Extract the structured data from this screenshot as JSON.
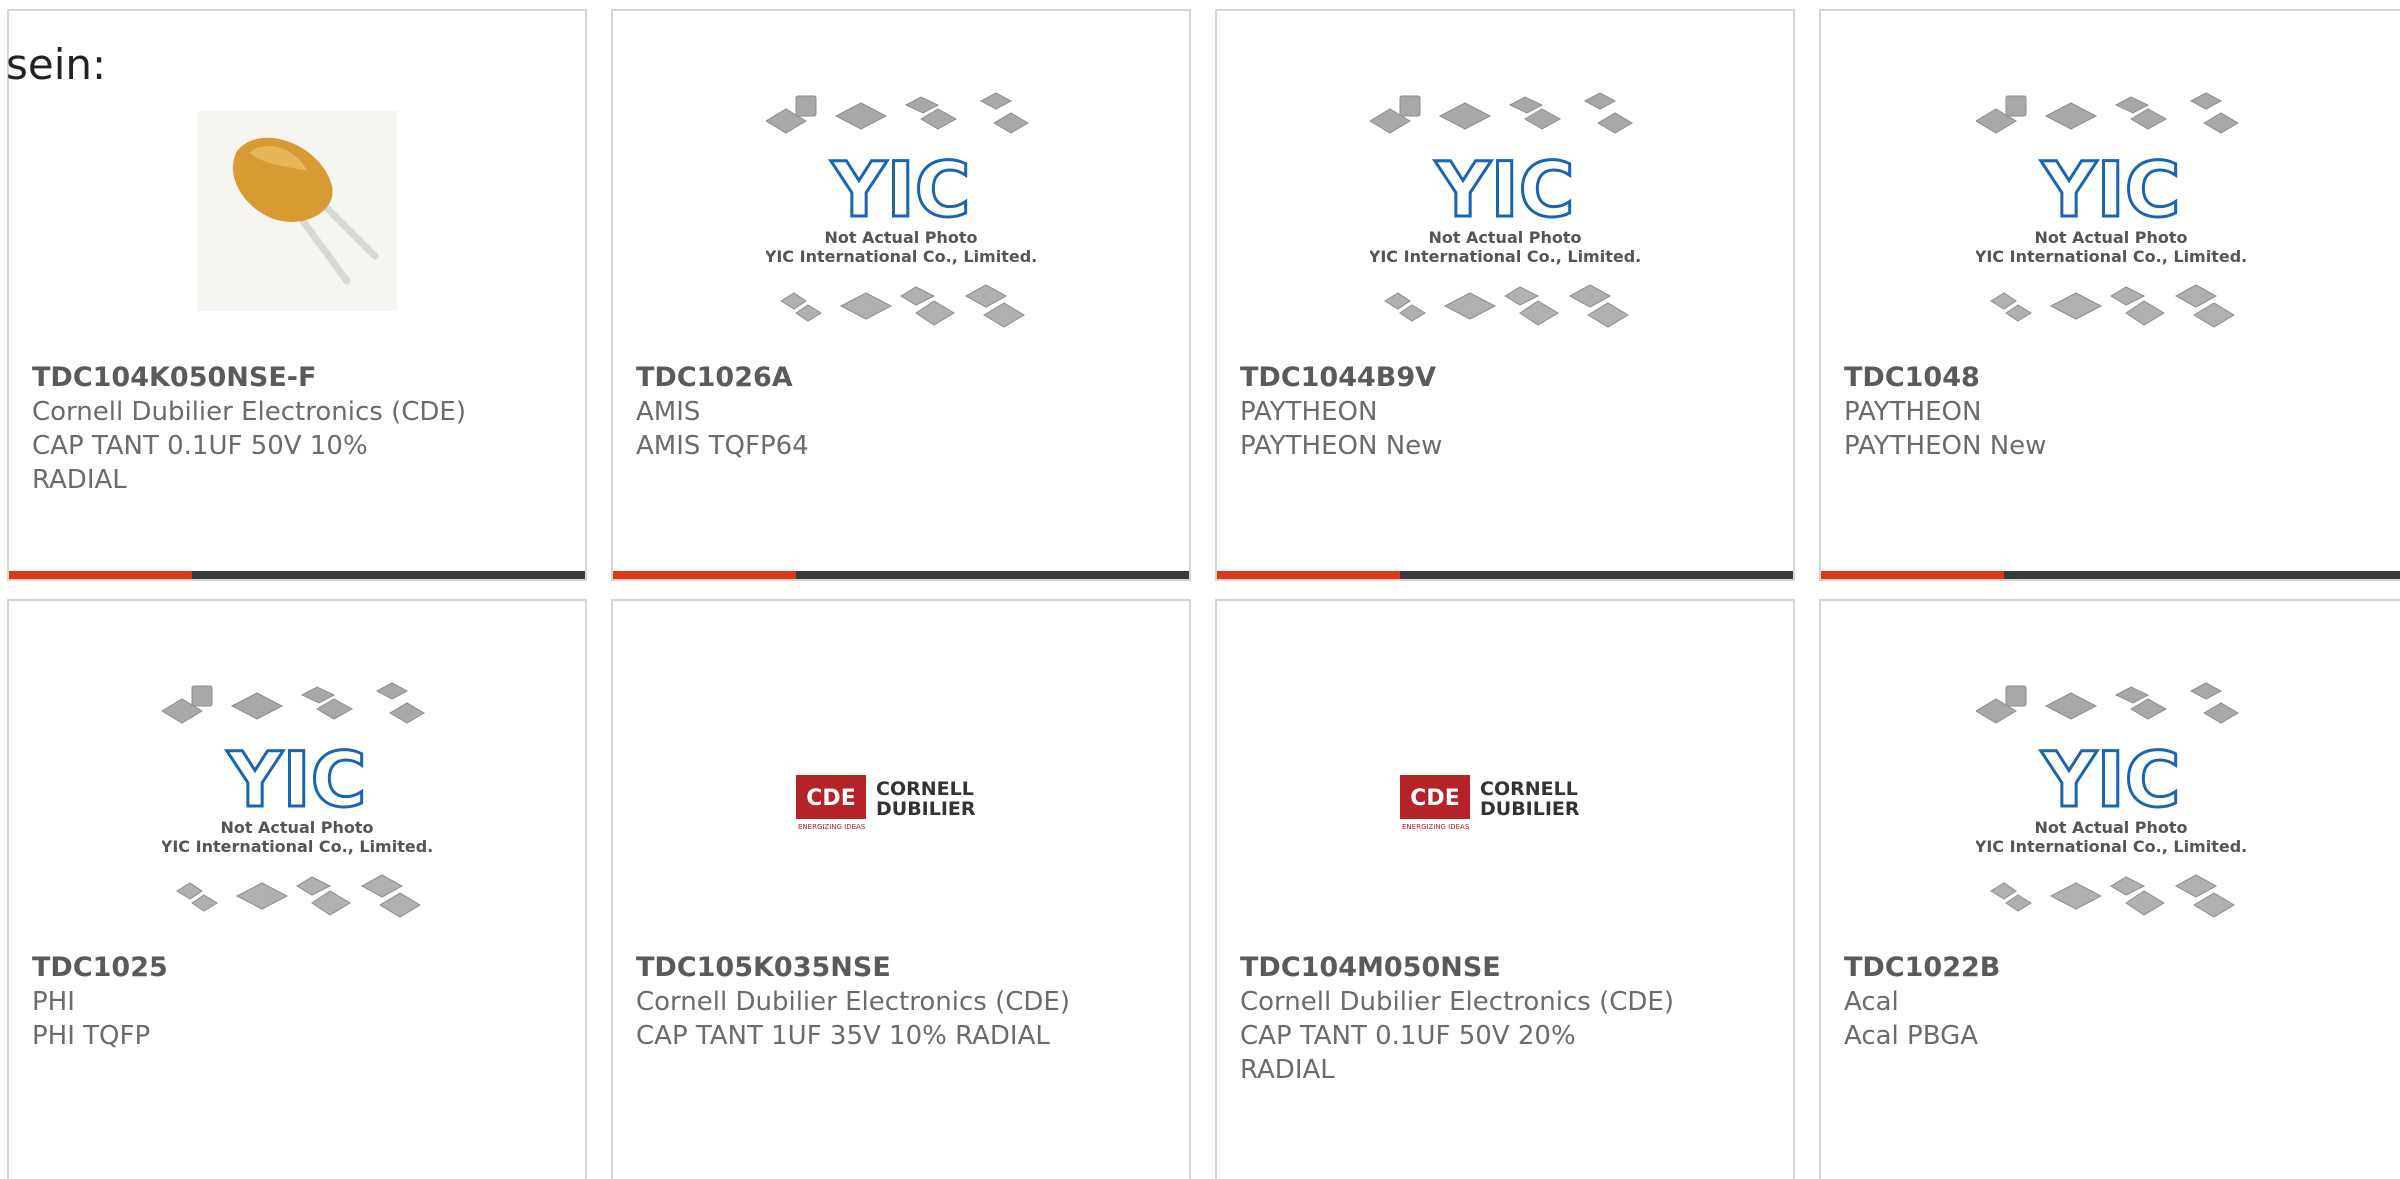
{
  "page": {
    "lead_text": "sein:"
  },
  "colors": {
    "accent_bar": "#e0361a",
    "bar": "#3a3a3a",
    "border": "#d5d5d5",
    "yic_blue": "#1a64b0",
    "cde_red": "#b52227"
  },
  "placeholder": {
    "caption_line1": "Not Actual Photo",
    "caption_line2": "YIC International Co., Limited.",
    "logo_text": "YIC"
  },
  "cde_logo": {
    "badge": "CDE",
    "line1": "CORNELL",
    "line2": "DUBILIER",
    "tagline": "ENERGIZING IDEAS"
  },
  "products": [
    {
      "part": "TDC104K050NSE-F",
      "maker": "Cornell Dubilier Electronics (CDE)",
      "desc_line1": "CAP TANT 0.1UF 50V 10%",
      "desc_line2": "RADIAL",
      "image": "capacitor-photo"
    },
    {
      "part": "TDC1026A",
      "maker": "AMIS",
      "desc_line1": "AMIS TQFP64",
      "desc_line2": "",
      "image": "yic-placeholder"
    },
    {
      "part": "TDC1044B9V",
      "maker": "PAYTHEON",
      "desc_line1": "PAYTHEON New",
      "desc_line2": "",
      "image": "yic-placeholder"
    },
    {
      "part": "TDC1048",
      "maker": "PAYTHEON",
      "desc_line1": "PAYTHEON New",
      "desc_line2": "",
      "image": "yic-placeholder"
    },
    {
      "part": "TDC1025",
      "maker": "PHI",
      "desc_line1": "PHI TQFP",
      "desc_line2": "",
      "image": "yic-placeholder"
    },
    {
      "part": "TDC105K035NSE",
      "maker": "Cornell Dubilier Electronics (CDE)",
      "desc_line1": "CAP TANT 1UF 35V 10% RADIAL",
      "desc_line2": "",
      "image": "cde-logo"
    },
    {
      "part": "TDC104M050NSE",
      "maker": "Cornell Dubilier Electronics (CDE)",
      "desc_line1": "CAP TANT 0.1UF 50V 20%",
      "desc_line2": "RADIAL",
      "image": "cde-logo"
    },
    {
      "part": "TDC1022B",
      "maker": "Acal",
      "desc_line1": "Acal PBGA",
      "desc_line2": "",
      "image": "yic-placeholder"
    }
  ]
}
